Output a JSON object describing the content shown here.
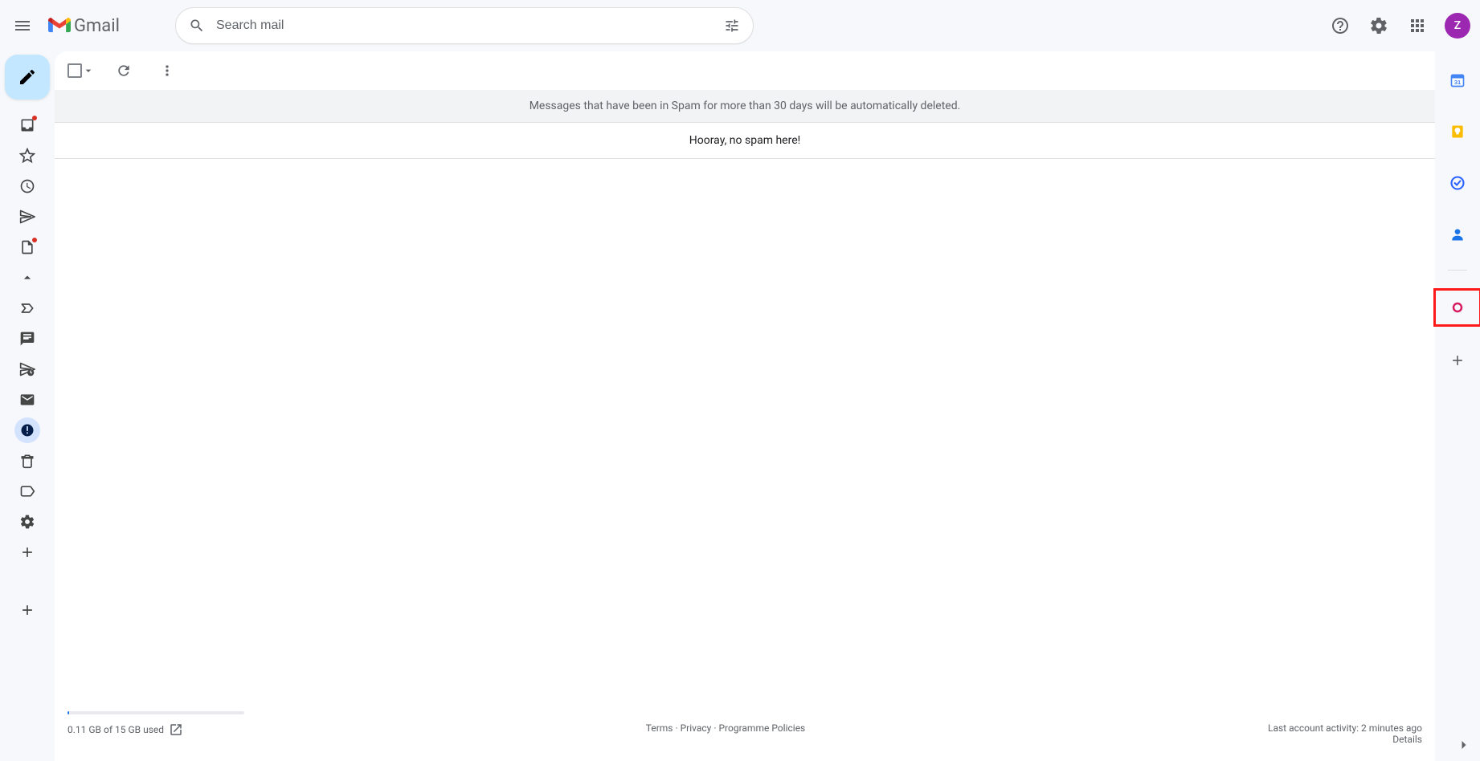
{
  "header": {
    "product": "Gmail",
    "search_placeholder": "Search mail",
    "avatar_initial": "Z"
  },
  "nav": {
    "compose": "Compose",
    "items": [
      {
        "name": "inbox",
        "badge": true
      },
      {
        "name": "starred"
      },
      {
        "name": "snoozed"
      },
      {
        "name": "sent"
      },
      {
        "name": "drafts",
        "badge": true
      },
      {
        "name": "less"
      },
      {
        "name": "important"
      },
      {
        "name": "chats"
      },
      {
        "name": "scheduled"
      },
      {
        "name": "all-mail"
      },
      {
        "name": "spam",
        "selected": true
      },
      {
        "name": "bin"
      },
      {
        "name": "categories"
      },
      {
        "name": "manage-labels"
      },
      {
        "name": "create-label"
      }
    ],
    "new_label": "New label"
  },
  "toolbar": {
    "select_all": "Select",
    "refresh": "Refresh",
    "more": "More"
  },
  "content": {
    "banner": "Messages that have been in Spam for more than 30 days will be automatically deleted.",
    "empty_message": "Hooray, no spam here!"
  },
  "footer": {
    "quota_used_text": "0.11 GB of 15 GB used",
    "quota_percent": 0.73,
    "terms": "Terms",
    "privacy": "Privacy",
    "policies": "Programme Policies",
    "activity": "Last account activity: 2 minutes ago",
    "details": "Details"
  },
  "side": {
    "items": [
      {
        "name": "calendar"
      },
      {
        "name": "keep"
      },
      {
        "name": "tasks"
      },
      {
        "name": "contacts"
      },
      {
        "name": "addon-highlighted"
      },
      {
        "name": "get-addons"
      }
    ]
  },
  "colors": {
    "compose_bg": "#c2e7ff",
    "selected_bg": "#d3e3fd",
    "avatar_bg": "#9c27b0",
    "highlight": "#ff1a1a"
  }
}
